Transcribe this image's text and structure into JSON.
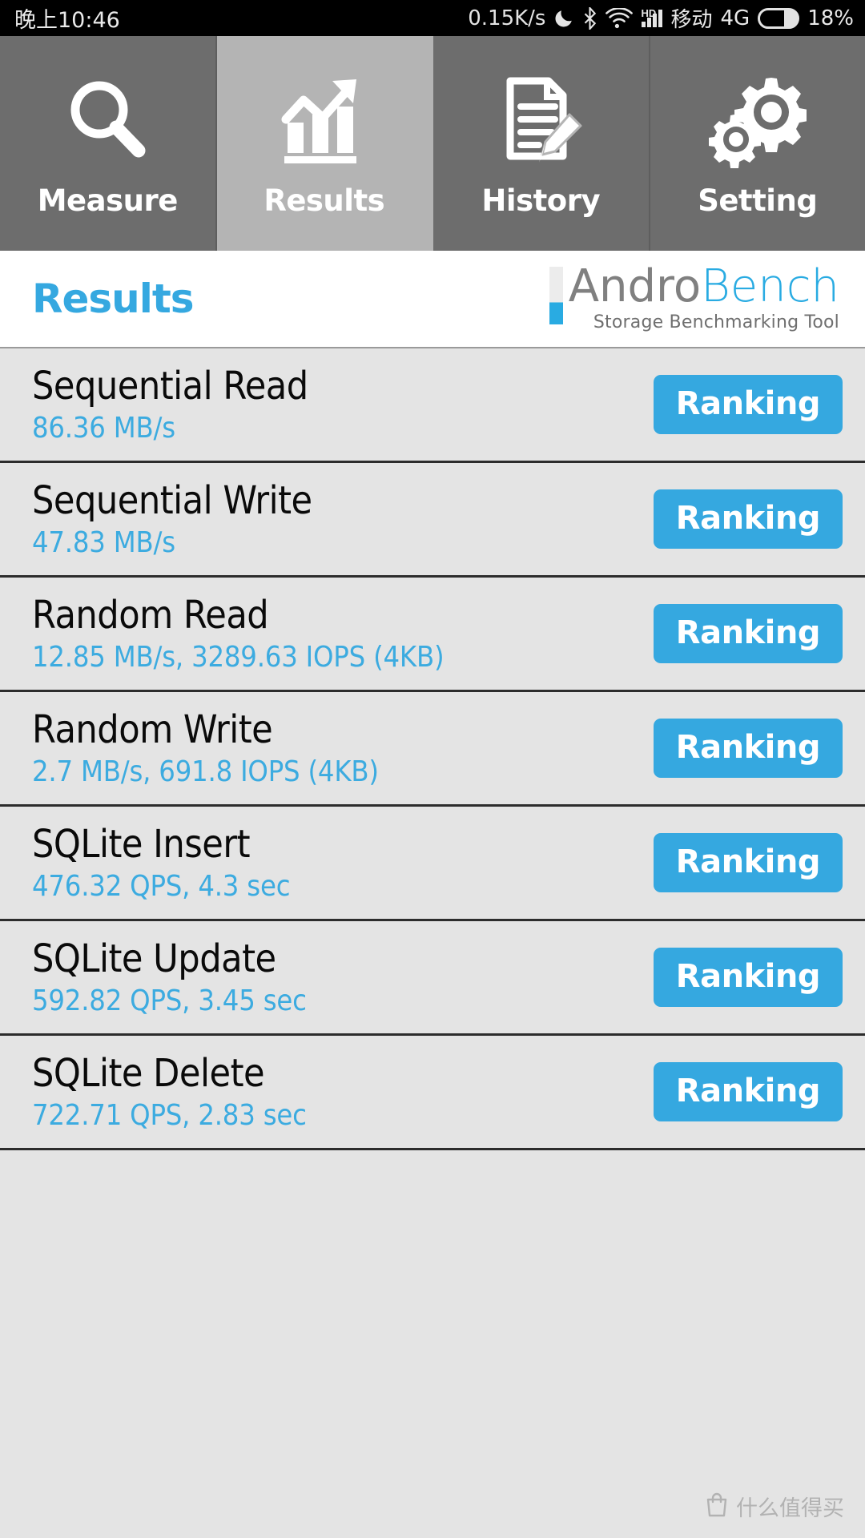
{
  "status_bar": {
    "time": "晚上10:46",
    "network_speed": "0.15K/s",
    "icons": [
      "do-not-disturb-moon-icon",
      "bluetooth-icon",
      "wifi-icon",
      "hd-signal-icon"
    ],
    "hd_label": "HD",
    "carrier": "移动",
    "network_type": "4G",
    "battery_percent": "18%"
  },
  "tabs": [
    {
      "label": "Measure",
      "icon": "magnifier-search-icon",
      "active": false
    },
    {
      "label": "Results",
      "icon": "bar-chart-growth-icon",
      "active": true
    },
    {
      "label": "History",
      "icon": "document-pencil-icon",
      "active": false
    },
    {
      "label": "Setting",
      "icon": "gears-icon",
      "active": false
    }
  ],
  "header": {
    "title": "Results",
    "logo_andro": "Andro",
    "logo_bench": "Bench",
    "logo_subtitle": "Storage Benchmarking Tool"
  },
  "results": [
    {
      "name": "Sequential Read",
      "value": "86.36 MB/s",
      "button": "Ranking"
    },
    {
      "name": "Sequential Write",
      "value": "47.83 MB/s",
      "button": "Ranking"
    },
    {
      "name": "Random Read",
      "value": "12.85 MB/s, 3289.63 IOPS (4KB)",
      "button": "Ranking"
    },
    {
      "name": "Random Write",
      "value": "2.7 MB/s, 691.8 IOPS (4KB)",
      "button": "Ranking"
    },
    {
      "name": "SQLite Insert",
      "value": "476.32 QPS, 4.3 sec",
      "button": "Ranking"
    },
    {
      "name": "SQLite Update",
      "value": "592.82 QPS, 3.45 sec",
      "button": "Ranking"
    },
    {
      "name": "SQLite Delete",
      "value": "722.71 QPS, 2.83 sec",
      "button": "Ranking"
    }
  ],
  "watermark": {
    "text": "什么值得买",
    "icon": "shopping-bag-icon"
  },
  "colors": {
    "accent_blue": "#35a8e0",
    "value_blue": "#3cabe0",
    "tab_inactive": "#6d6d6d",
    "tab_active": "#b4b4b4",
    "list_bg": "#e4e4e4",
    "divider": "#2c2c2c"
  }
}
